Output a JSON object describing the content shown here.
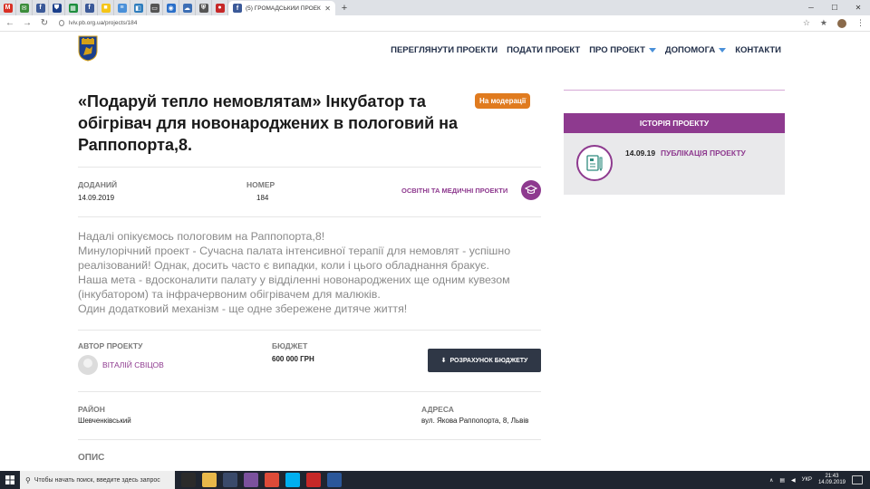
{
  "browser": {
    "pinned_tabs": [
      {
        "icon": "gmail-icon",
        "color": "#d93025",
        "glyph": "M"
      },
      {
        "icon": "mail-icon",
        "color": "#3c8d3c",
        "glyph": "✉"
      },
      {
        "icon": "facebook-icon",
        "color": "#3b5998",
        "glyph": "f"
      },
      {
        "icon": "crest-icon",
        "color": "#1b3f8b",
        "glyph": "⛊"
      },
      {
        "icon": "sheets-icon",
        "color": "#1e8e3e",
        "glyph": "▦"
      },
      {
        "icon": "facebook-icon",
        "color": "#3b5998",
        "glyph": "f"
      },
      {
        "icon": "ukraine-flag-icon",
        "color": "#f5c518",
        "glyph": "■"
      },
      {
        "icon": "doc-icon",
        "color": "#4a90d9",
        "glyph": "≡"
      },
      {
        "icon": "site-icon",
        "color": "#2e7dbd",
        "glyph": "◧"
      },
      {
        "icon": "monitor-icon",
        "color": "#555555",
        "glyph": "▭"
      },
      {
        "icon": "eye-icon",
        "color": "#2a6fc9",
        "glyph": "◉"
      },
      {
        "icon": "cloud-icon",
        "color": "#3d6fb5",
        "glyph": "☁"
      },
      {
        "icon": "shield-icon",
        "color": "#555555",
        "glyph": "⛨"
      },
      {
        "icon": "pin-icon",
        "color": "#c62828",
        "glyph": "●"
      }
    ],
    "active_tab_title": "(5) ГРОМАДСЬКИЙ ПРОЕКТ \"ДА",
    "url": "lviv.pb.org.ua/projects/184"
  },
  "nav": {
    "items": [
      {
        "label": "ПЕРЕГЛЯНУТИ ПРОЕКТИ",
        "caret": false
      },
      {
        "label": "ПОДАТИ ПРОЕКТ",
        "caret": false
      },
      {
        "label": "ПРО ПРОЕКТ",
        "caret": true
      },
      {
        "label": "ДОПОМОГА",
        "caret": true
      },
      {
        "label": "КОНТАКТИ",
        "caret": false
      }
    ]
  },
  "project": {
    "title": "«Подаруй тепло немовлятам» Інкубатор та обігрівач для новонароджених в пологовий на Раппопорта,8.",
    "status_badge": "На модерації",
    "added_label": "ДОДАНИЙ",
    "added_value": "14.09.2019",
    "number_label": "НОМЕР",
    "number_value": "184",
    "category": "ОСВІТНІ ТА МЕДИЧНІ ПРОЕКТИ",
    "description": [
      "Надалі опікуємось пологовим на Раппопорта,8!",
      "Минулорічний проект - Сучасна палата інтенсивної терапії для немовлят - успішно реалізований! Однак, досить часто є випадки, коли і цього обладнання бракує.",
      "Наша мета - вдосконалити палату у відділенні новонароджених ще одним кувезом (інкубатором) та інфрачервоним обігрівачем для малюків.",
      "Один додатковий механізм - ще одне збережене дитяче життя!"
    ],
    "author_label": "АВТОР ПРОЕКТУ",
    "author_name": "ВІТАЛІЙ СВІЦОВ",
    "budget_label": "БЮДЖЕТ",
    "budget_value": "600 000 ГРН",
    "budget_button": "РОЗРАХУНОК БЮДЖЕТУ",
    "district_label": "РАЙОН",
    "district_value": "Шевченківський",
    "address_label": "АДРЕСА",
    "address_value": "вул. Якова Раппопорта, 8, Львів",
    "section_label": "ОПИС"
  },
  "history": {
    "heading": "ІСТОРІЯ ПРОЕКТУ",
    "date": "14.09.19",
    "event": "ПУБЛІКАЦІЯ ПРОЕКТУ"
  },
  "taskbar": {
    "search_placeholder": "Чтобы начать поиск, введите здесь запрос",
    "apps": [
      {
        "icon": "store-icon",
        "color": "#2b2b2b"
      },
      {
        "icon": "folder-icon",
        "color": "#e8b84a"
      },
      {
        "icon": "photo-icon",
        "color": "#3a4a6a"
      },
      {
        "icon": "viber-icon",
        "color": "#7b519d"
      },
      {
        "icon": "chrome-icon",
        "color": "#dd4b39"
      },
      {
        "icon": "skype-icon",
        "color": "#00aff0"
      },
      {
        "icon": "app-icon",
        "color": "#c62828"
      },
      {
        "icon": "word-icon",
        "color": "#2b579a"
      }
    ],
    "lang": "УКР",
    "time": "21:43",
    "date": "14.09.2019"
  },
  "colors": {
    "brand_purple": "#8e3a8f",
    "badge_orange": "#e07b1f",
    "button_dark": "#2f3746",
    "nav_text": "#23304a"
  }
}
